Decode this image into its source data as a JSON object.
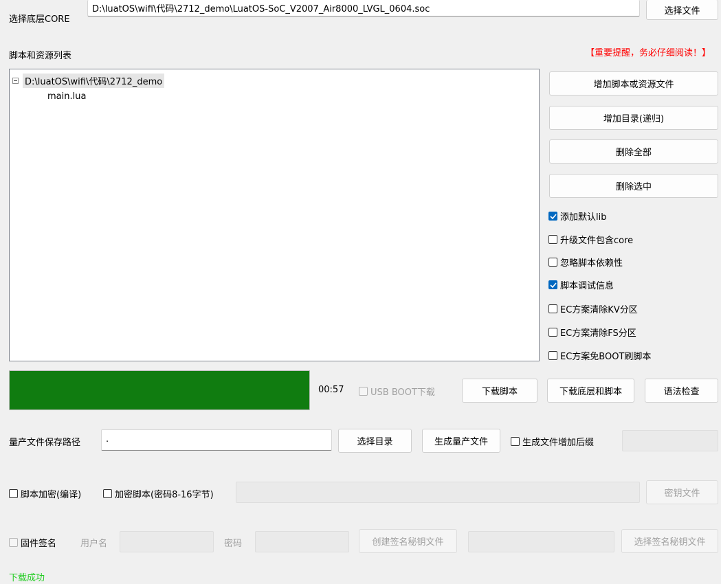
{
  "core": {
    "label": "选择底层CORE",
    "path": "D:\\luatOS\\wifi\\代码\\2712_demo\\LuatOS-SoC_V2007_Air8000_LVGL_0604.soc",
    "select_button": "选择文件"
  },
  "scripts": {
    "label": "脚本和资源列表",
    "warning": "【重要提醒，务必仔细阅读！】",
    "tree_root": "D:\\luatOS\\wifi\\代码\\2712_demo",
    "tree_children": [
      "main.lua"
    ]
  },
  "side_buttons": {
    "add_file": "增加脚本或资源文件",
    "add_dir": "增加目录(递归)",
    "delete_all": "删除全部",
    "delete_selected": "删除选中"
  },
  "options": [
    {
      "label": "添加默认lib",
      "checked": true
    },
    {
      "label": "升级文件包含core",
      "checked": false
    },
    {
      "label": "忽略脚本依赖性",
      "checked": false
    },
    {
      "label": "脚本调试信息",
      "checked": true
    },
    {
      "label": "EC方案清除KV分区",
      "checked": false
    },
    {
      "label": "EC方案清除FS分区",
      "checked": false
    },
    {
      "label": "EC方案免BOOT刷脚本",
      "checked": false
    }
  ],
  "download": {
    "progress": 1.0,
    "progress_color": "#107c10",
    "time": "00:57",
    "usb_boot": "USB BOOT下载",
    "download_script": "下载脚本",
    "download_core_script": "下载底层和脚本",
    "syntax_check": "语法检查"
  },
  "mass": {
    "label": "量产文件保存路径",
    "path": ".",
    "select_dir": "选择目录",
    "generate": "生成量产文件",
    "suffix_label": "生成文件增加后缀",
    "suffix_value": ""
  },
  "encrypt": {
    "compile_label": "脚本加密(编译)",
    "encrypt_label": "加密脚本(密码8-16字节)",
    "key_value": "",
    "key_file_button": "密钥文件"
  },
  "sign": {
    "firmware_sign": "固件签名",
    "username_label": "用户名",
    "username_value": "",
    "password_label": "密码",
    "password_value": "",
    "create_key_button": "创建签名秘钥文件",
    "key_path_value": "",
    "select_key_button": "选择签名秘钥文件"
  },
  "status": {
    "text": "下载成功",
    "color": "#22cc22"
  }
}
